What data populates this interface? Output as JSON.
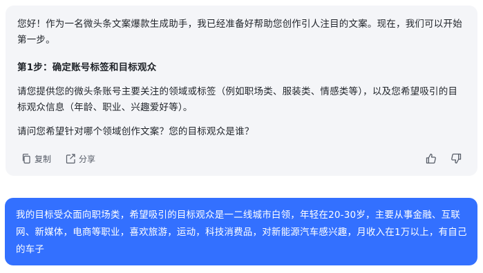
{
  "assistant": {
    "greeting": "您好！作为一名微头条文案爆款生成助手，我已经准备好帮助您创作引人注目的文案。现在，我们可以开始第一步。",
    "step_title": "第1步：确定账号标签和目标观众",
    "request": "请您提供您的微头条账号主要关注的领域或标签（例如职场类、服装类、情感类等），以及您希望吸引的目标观众信息（年龄、职业、兴趣爱好等）。",
    "question": "请问您希望针对哪个领域创作文案？您的目标观众是谁？",
    "actions": {
      "copy_label": "复制",
      "share_label": "分享"
    }
  },
  "user": {
    "message": "我的目标受众面向职场类，希望吸引的目标观众是一二线城市白领，年轻在20-30岁，主要从事金融、互联网、新媒体，电商等职业，喜欢旅游，运动，科技消费品，对新能源汽车感兴趣，月收入在1万以上，有自己的车子"
  },
  "icons": {
    "copy": "copy-icon",
    "share": "share-icon",
    "like": "thumbs-up-icon",
    "dislike": "thumbs-down-icon"
  },
  "colors": {
    "assistant_bg": "#f4f5f8",
    "user_bg": "#3370ff",
    "text": "#1f2329",
    "muted": "#555b66"
  }
}
